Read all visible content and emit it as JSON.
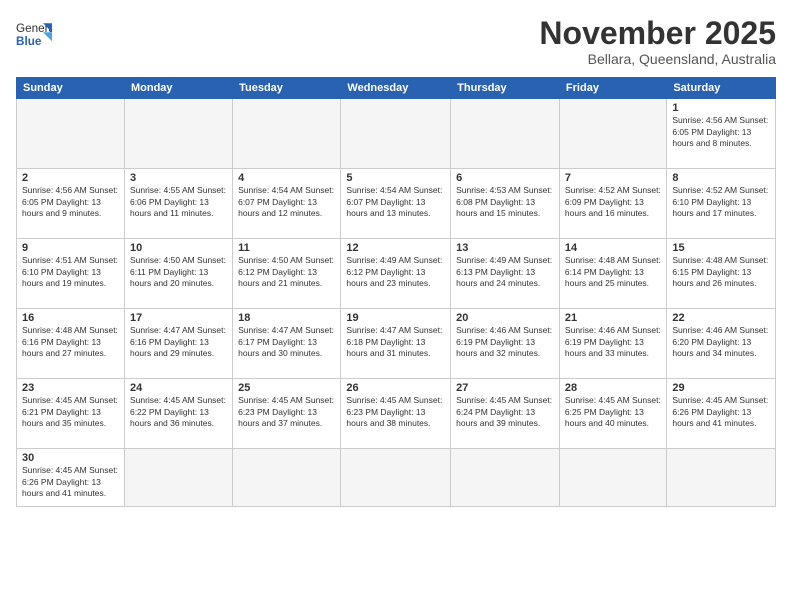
{
  "header": {
    "logo_general": "General",
    "logo_blue": "Blue",
    "month_title": "November 2025",
    "subtitle": "Bellara, Queensland, Australia"
  },
  "weekdays": [
    "Sunday",
    "Monday",
    "Tuesday",
    "Wednesday",
    "Thursday",
    "Friday",
    "Saturday"
  ],
  "weeks": [
    [
      {
        "day": "",
        "info": ""
      },
      {
        "day": "",
        "info": ""
      },
      {
        "day": "",
        "info": ""
      },
      {
        "day": "",
        "info": ""
      },
      {
        "day": "",
        "info": ""
      },
      {
        "day": "",
        "info": ""
      },
      {
        "day": "1",
        "info": "Sunrise: 4:56 AM\nSunset: 6:05 PM\nDaylight: 13 hours\nand 8 minutes."
      }
    ],
    [
      {
        "day": "2",
        "info": "Sunrise: 4:56 AM\nSunset: 6:05 PM\nDaylight: 13 hours\nand 9 minutes."
      },
      {
        "day": "3",
        "info": "Sunrise: 4:55 AM\nSunset: 6:06 PM\nDaylight: 13 hours\nand 11 minutes."
      },
      {
        "day": "4",
        "info": "Sunrise: 4:54 AM\nSunset: 6:07 PM\nDaylight: 13 hours\nand 12 minutes."
      },
      {
        "day": "5",
        "info": "Sunrise: 4:54 AM\nSunset: 6:07 PM\nDaylight: 13 hours\nand 13 minutes."
      },
      {
        "day": "6",
        "info": "Sunrise: 4:53 AM\nSunset: 6:08 PM\nDaylight: 13 hours\nand 15 minutes."
      },
      {
        "day": "7",
        "info": "Sunrise: 4:52 AM\nSunset: 6:09 PM\nDaylight: 13 hours\nand 16 minutes."
      },
      {
        "day": "8",
        "info": "Sunrise: 4:52 AM\nSunset: 6:10 PM\nDaylight: 13 hours\nand 17 minutes."
      }
    ],
    [
      {
        "day": "9",
        "info": "Sunrise: 4:51 AM\nSunset: 6:10 PM\nDaylight: 13 hours\nand 19 minutes."
      },
      {
        "day": "10",
        "info": "Sunrise: 4:50 AM\nSunset: 6:11 PM\nDaylight: 13 hours\nand 20 minutes."
      },
      {
        "day": "11",
        "info": "Sunrise: 4:50 AM\nSunset: 6:12 PM\nDaylight: 13 hours\nand 21 minutes."
      },
      {
        "day": "12",
        "info": "Sunrise: 4:49 AM\nSunset: 6:12 PM\nDaylight: 13 hours\nand 23 minutes."
      },
      {
        "day": "13",
        "info": "Sunrise: 4:49 AM\nSunset: 6:13 PM\nDaylight: 13 hours\nand 24 minutes."
      },
      {
        "day": "14",
        "info": "Sunrise: 4:48 AM\nSunset: 6:14 PM\nDaylight: 13 hours\nand 25 minutes."
      },
      {
        "day": "15",
        "info": "Sunrise: 4:48 AM\nSunset: 6:15 PM\nDaylight: 13 hours\nand 26 minutes."
      }
    ],
    [
      {
        "day": "16",
        "info": "Sunrise: 4:48 AM\nSunset: 6:16 PM\nDaylight: 13 hours\nand 27 minutes."
      },
      {
        "day": "17",
        "info": "Sunrise: 4:47 AM\nSunset: 6:16 PM\nDaylight: 13 hours\nand 29 minutes."
      },
      {
        "day": "18",
        "info": "Sunrise: 4:47 AM\nSunset: 6:17 PM\nDaylight: 13 hours\nand 30 minutes."
      },
      {
        "day": "19",
        "info": "Sunrise: 4:47 AM\nSunset: 6:18 PM\nDaylight: 13 hours\nand 31 minutes."
      },
      {
        "day": "20",
        "info": "Sunrise: 4:46 AM\nSunset: 6:19 PM\nDaylight: 13 hours\nand 32 minutes."
      },
      {
        "day": "21",
        "info": "Sunrise: 4:46 AM\nSunset: 6:19 PM\nDaylight: 13 hours\nand 33 minutes."
      },
      {
        "day": "22",
        "info": "Sunrise: 4:46 AM\nSunset: 6:20 PM\nDaylight: 13 hours\nand 34 minutes."
      }
    ],
    [
      {
        "day": "23",
        "info": "Sunrise: 4:45 AM\nSunset: 6:21 PM\nDaylight: 13 hours\nand 35 minutes."
      },
      {
        "day": "24",
        "info": "Sunrise: 4:45 AM\nSunset: 6:22 PM\nDaylight: 13 hours\nand 36 minutes."
      },
      {
        "day": "25",
        "info": "Sunrise: 4:45 AM\nSunset: 6:23 PM\nDaylight: 13 hours\nand 37 minutes."
      },
      {
        "day": "26",
        "info": "Sunrise: 4:45 AM\nSunset: 6:23 PM\nDaylight: 13 hours\nand 38 minutes."
      },
      {
        "day": "27",
        "info": "Sunrise: 4:45 AM\nSunset: 6:24 PM\nDaylight: 13 hours\nand 39 minutes."
      },
      {
        "day": "28",
        "info": "Sunrise: 4:45 AM\nSunset: 6:25 PM\nDaylight: 13 hours\nand 40 minutes."
      },
      {
        "day": "29",
        "info": "Sunrise: 4:45 AM\nSunset: 6:26 PM\nDaylight: 13 hours\nand 41 minutes."
      }
    ],
    [
      {
        "day": "30",
        "info": "Sunrise: 4:45 AM\nSunset: 6:26 PM\nDaylight: 13 hours\nand 41 minutes."
      },
      {
        "day": "",
        "info": ""
      },
      {
        "day": "",
        "info": ""
      },
      {
        "day": "",
        "info": ""
      },
      {
        "day": "",
        "info": ""
      },
      {
        "day": "",
        "info": ""
      },
      {
        "day": "",
        "info": ""
      }
    ]
  ]
}
